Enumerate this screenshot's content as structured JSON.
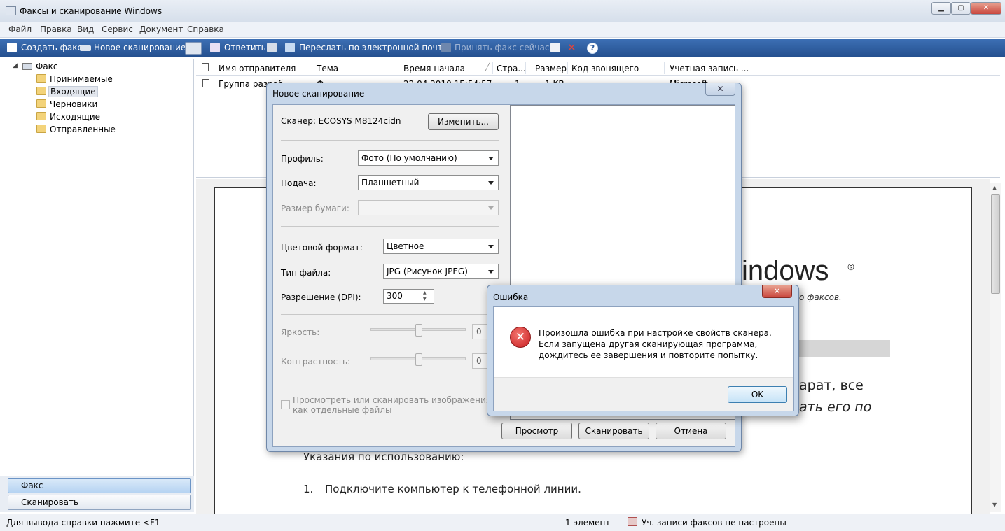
{
  "window": {
    "title": "Факсы и сканирование Windows"
  },
  "menu": [
    "Файл",
    "Правка",
    "Вид",
    "Сервис",
    "Документ",
    "Справка"
  ],
  "toolbar": {
    "create_fax": "Создать факс",
    "new_scan": "Новое сканирование",
    "reply": "Ответить",
    "forward_email": "Переслать по электронной почте",
    "receive_fax": "Принять факс сейчас"
  },
  "tree": {
    "root": "Факс",
    "items": [
      "Принимаемые",
      "Входящие",
      "Черновики",
      "Исходящие",
      "Отправленные"
    ]
  },
  "nav": {
    "fax": "Факс",
    "scan": "Сканировать"
  },
  "list": {
    "columns": [
      "Имя отправителя",
      "Тема",
      "Время начала",
      "Стра...",
      "Размер",
      "Код звонящего",
      "Учетная запись ..."
    ],
    "row": {
      "sender": "Группа разраб",
      "subject": "Ф",
      "time": "22.04.2010 15:54:57",
      "pages": "1",
      "size": "1 KB",
      "account": "Microsoft"
    }
  },
  "preview": {
    "logo_text": "indows",
    "reg_mark": "®",
    "tagline": "о факсов.",
    "line1": "арат, все",
    "line2": "ать его по",
    "instructions_title": "Указания по использованию:",
    "step1_num": "1.",
    "step1": "Подключите компьютер к телефонной линии."
  },
  "status": {
    "help": "Для вывода справки нажмите <F1",
    "count": "1 элемент",
    "accounts": "Уч. записи факсов не настроены"
  },
  "scan_dialog": {
    "title": "Новое сканирование",
    "scanner_label": "Сканер: ECOSYS M8124cidn",
    "change_button": "Изменить...",
    "profile_label": "Профиль:",
    "profile_value": "Фото (По умолчанию)",
    "source_label": "Подача:",
    "source_value": "Планшетный",
    "paper_label": "Размер бумаги:",
    "color_label": "Цветовой формат:",
    "color_value": "Цветное",
    "filetype_label": "Тип файла:",
    "filetype_value": "JPG (Рисунок JPEG)",
    "dpi_label": "Разрешение (DPI):",
    "dpi_value": "300",
    "brightness_label": "Яркость:",
    "brightness_value": "0",
    "contrast_label": "Контрастность:",
    "contrast_value": "0",
    "separate_files": "Просмотреть или сканировать изображения как отдельные файлы",
    "preview_button": "Просмотр",
    "scan_button": "Сканировать",
    "cancel_button": "Отмена"
  },
  "error_dialog": {
    "title": "Ошибка",
    "message": "Произошла ошибка при настройке свойств сканера. Если запущена другая сканирующая программа, дождитесь ее завершения и повторите попытку.",
    "ok_button": "OK"
  },
  "colors": {
    "toolbar": "#2b5a9c",
    "error_red": "#d8232a",
    "close_red": "#c9463d"
  }
}
